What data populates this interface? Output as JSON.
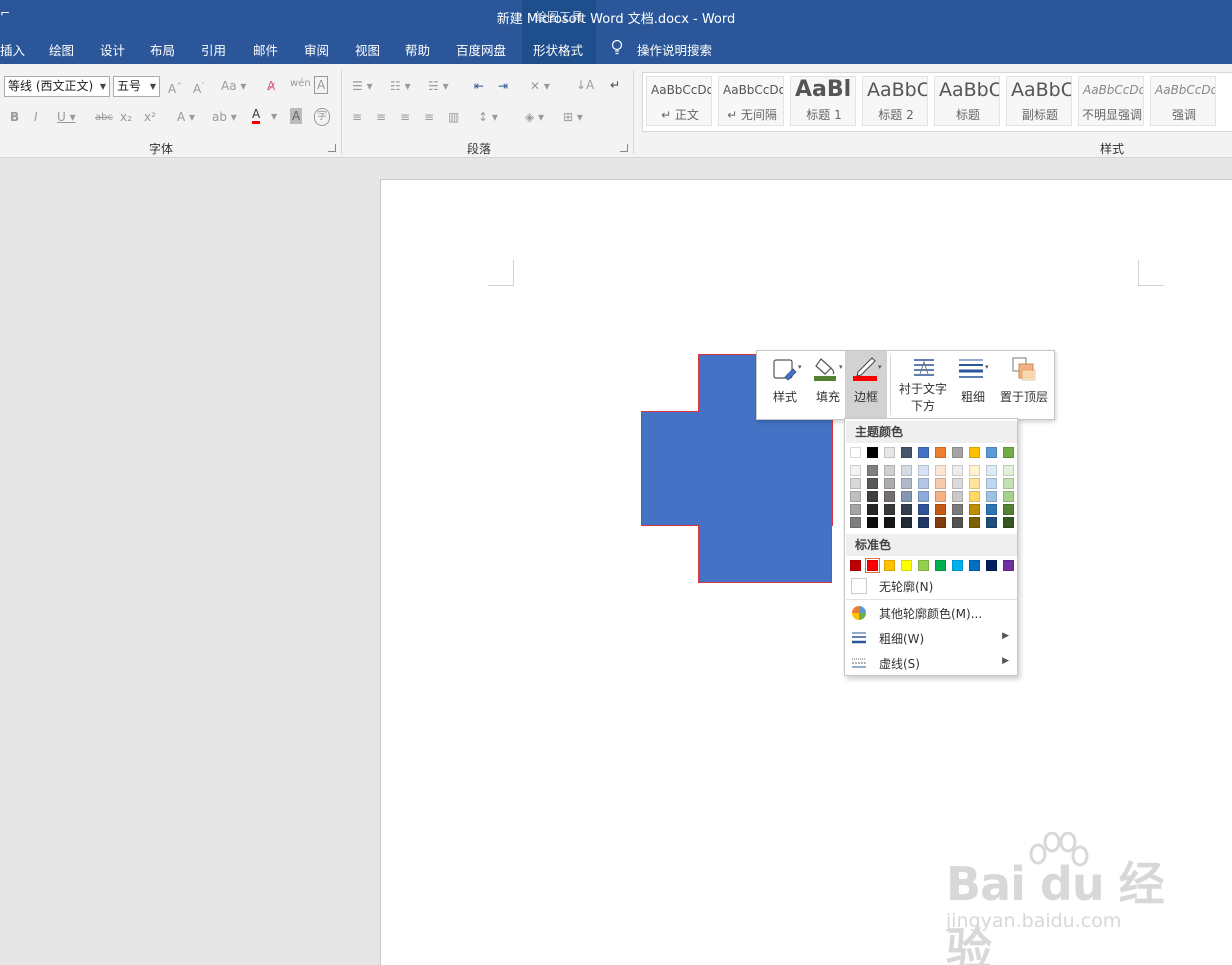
{
  "title_bar": {
    "quick_access_glyph": "⌐",
    "document_title": "新建 Microsoft Word 文档.docx  -  Word",
    "contextual_group": "绘图工具"
  },
  "tabs": [
    {
      "label": "插入"
    },
    {
      "label": "绘图"
    },
    {
      "label": "设计"
    },
    {
      "label": "布局"
    },
    {
      "label": "引用"
    },
    {
      "label": "邮件"
    },
    {
      "label": "审阅"
    },
    {
      "label": "视图"
    },
    {
      "label": "帮助"
    },
    {
      "label": "百度网盘"
    },
    {
      "label": "形状格式",
      "active": true
    }
  ],
  "tell_me": "操作说明搜索",
  "ribbon": {
    "font_group": {
      "label": "字体",
      "font_name": "等线 (西文正文)",
      "font_size": "五号"
    },
    "paragraph_group": {
      "label": "段落"
    },
    "styles_group": {
      "label": "样式",
      "styles": [
        {
          "sample": "AaBbCcDd",
          "name": "↵ 正文",
          "kind": "normal"
        },
        {
          "sample": "AaBbCcDd",
          "name": "↵ 无间隔",
          "kind": "normal"
        },
        {
          "sample": "AaBl",
          "name": "标题 1",
          "kind": "big"
        },
        {
          "sample": "AaBbC",
          "name": "标题 2",
          "kind": "mid"
        },
        {
          "sample": "AaBbC",
          "name": "标题",
          "kind": "mid"
        },
        {
          "sample": "AaBbC",
          "name": "副标题",
          "kind": "mid"
        },
        {
          "sample": "AaBbCcDd",
          "name": "不明显强调",
          "kind": "ital"
        },
        {
          "sample": "AaBbCcDd",
          "name": "强调",
          "kind": "ital"
        }
      ]
    }
  },
  "shape": {
    "fill": "#4472c4",
    "outline": "#e0323c"
  },
  "mini_toolbar": {
    "style": "样式",
    "fill": "填充",
    "border": "边框",
    "behind_text_line1": "衬于文字",
    "behind_text_line2": "下方",
    "weight": "粗细",
    "bring_front": "置于顶层"
  },
  "border_menu": {
    "theme_colors_header": "主题颜色",
    "theme_top_row": [
      "#ffffff",
      "#000000",
      "#e7e6e6",
      "#44546a",
      "#4472c4",
      "#ed7d31",
      "#a5a5a5",
      "#ffc000",
      "#5b9bd5",
      "#70ad47"
    ],
    "theme_shades": [
      [
        "#f2f2f2",
        "#7f7f7f",
        "#d0cece",
        "#d6dce4",
        "#d9e2f3",
        "#fbe5d5",
        "#ededed",
        "#fff2cc",
        "#deebf6",
        "#e2efd9"
      ],
      [
        "#d8d8d8",
        "#595959",
        "#aeabab",
        "#adb9ca",
        "#b4c6e7",
        "#f7cbac",
        "#dbdbdb",
        "#fee599",
        "#bdd7ee",
        "#c5e0b3"
      ],
      [
        "#bfbfbf",
        "#3f3f3f",
        "#757070",
        "#8496b0",
        "#8eaadb",
        "#f4b183",
        "#c9c9c9",
        "#ffd965",
        "#9cc3e5",
        "#a8d08d"
      ],
      [
        "#a5a5a5",
        "#262626",
        "#3a3838",
        "#323f4f",
        "#2f5496",
        "#c55a11",
        "#7b7b7b",
        "#bf8f00",
        "#2e75b5",
        "#538135"
      ],
      [
        "#7f7f7f",
        "#0c0c0c",
        "#171616",
        "#222a35",
        "#1f3864",
        "#833c0b",
        "#525252",
        "#7f6000",
        "#1e4e79",
        "#375623"
      ]
    ],
    "standard_header": "标准色",
    "standard_colors": [
      "#c00000",
      "#ff0000",
      "#ffc000",
      "#ffff00",
      "#92d050",
      "#00b050",
      "#00b0f0",
      "#0070c0",
      "#002060",
      "#7030a0"
    ],
    "no_outline": "无轮廓(N)",
    "more_colors": "其他轮廓颜色(M)...",
    "weight": "粗细(W)",
    "dashes": "虚线(S)"
  },
  "watermark": {
    "brand": "Bai du 经验",
    "site": "jingyan.baidu.com"
  }
}
